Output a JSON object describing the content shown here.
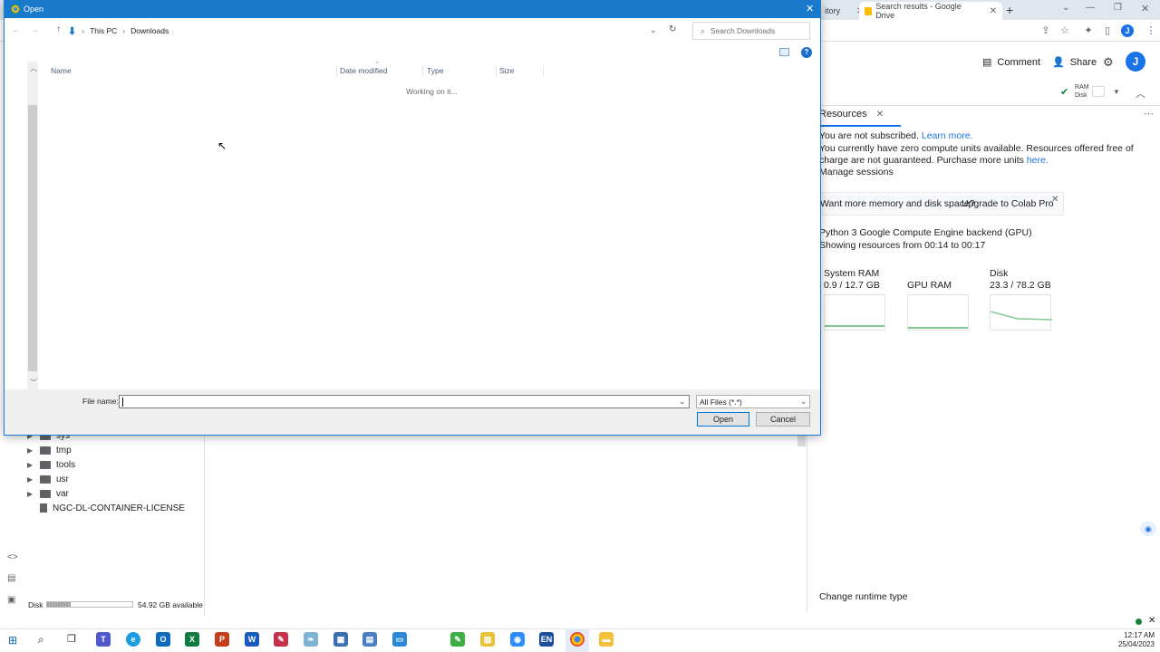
{
  "browser": {
    "tabs": [
      {
        "label": "itory",
        "active": false
      },
      {
        "label": "Search results - Google Drive",
        "active": false
      }
    ],
    "new_tab": "+",
    "avatar_letter": "J"
  },
  "colab": {
    "comment_label": "Comment",
    "share_label": "Share",
    "avatar_letter": "J",
    "ram_label": "RAM",
    "disk_label": "Disk"
  },
  "resources": {
    "tab_label": "Resources",
    "not_subscribed": "You are not subscribed.",
    "learn_more": "Learn more.",
    "compute_msg": "You currently have zero compute units available. Resources offered free of charge are not guaranteed. Purchase more units",
    "here_link": "here.",
    "manage_sessions": "Manage sessions",
    "upsell_text": "Want more memory and disk space?",
    "upsell_link": "Upgrade to Colab Pro",
    "backend": "Python 3 Google Compute Engine backend (GPU)",
    "showing": "Showing resources from 00:14 to 00:17",
    "gauges": [
      {
        "label": "System RAM",
        "value": "0.9 / 12.7 GB",
        "fraction": 0.07
      },
      {
        "label": "GPU RAM",
        "value": "",
        "fraction": 0.0
      },
      {
        "label": "Disk",
        "value": "23.3 / 78.2 GB",
        "fraction": 0.3
      }
    ],
    "change_runtime": "Change runtime type"
  },
  "file_tree": {
    "items": [
      "sys",
      "tmp",
      "tools",
      "usr",
      "var"
    ],
    "file": "NGC-DL-CONTAINER-LICENSE",
    "disk_label": "Disk",
    "disk_available": "54.92 GB available",
    "disk_fraction": 0.28
  },
  "dialog": {
    "title": "Open",
    "breadcrumb": [
      "This PC",
      "Downloads"
    ],
    "search_placeholder": "Search Downloads",
    "columns": [
      "Name",
      "Date modified",
      "Type",
      "Size"
    ],
    "status": "Working on it...",
    "file_name_label": "File name:",
    "file_name_value": "",
    "filter_value": "All Files (*.*)",
    "open_label": "Open",
    "cancel_label": "Cancel"
  },
  "taskbar": {
    "time": "12:17 AM",
    "date": "25/04/2023",
    "lang": "EN"
  },
  "colors": {
    "dialog_title": "#1979ca",
    "link": "#1a73e8",
    "accent": "#1a73e8"
  }
}
